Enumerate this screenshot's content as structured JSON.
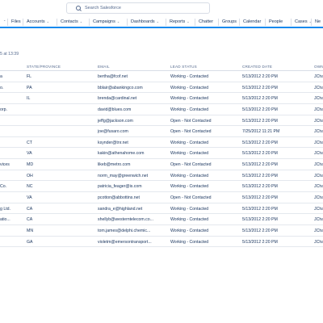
{
  "search": {
    "placeholder": "Search Salesforce"
  },
  "nav": {
    "items": [
      {
        "label": "Files",
        "dropdown": false
      },
      {
        "label": "Accounts",
        "dropdown": true
      },
      {
        "label": "Contacts",
        "dropdown": true
      },
      {
        "label": "Campaigns",
        "dropdown": true
      },
      {
        "label": "Dashboards",
        "dropdown": true
      },
      {
        "label": "Reports",
        "dropdown": true
      },
      {
        "label": "Chatter",
        "dropdown": false
      },
      {
        "label": "Groups",
        "dropdown": false
      },
      {
        "label": "Calendar",
        "dropdown": false
      },
      {
        "label": "People",
        "dropdown": false
      },
      {
        "label": "Cases",
        "dropdown": true
      },
      {
        "label": "Ne",
        "dropdown": false
      }
    ]
  },
  "subtitle": "5 at 13:39",
  "table": {
    "columns": [
      "",
      "STATE/PROVINCE",
      "EMAIL",
      "LEAD STATUS",
      "CREATED DATE",
      "OWN"
    ],
    "rows": [
      [
        "a",
        "FL",
        "bertha@fcof.net",
        "Working - Contacted",
        "5/13/2012 2:20 PM",
        "JCha"
      ],
      [
        "o.",
        "PA",
        "bblair@abankingco.com",
        "Working - Contacted",
        "5/13/2012 2:20 PM",
        "JCha"
      ],
      [
        "",
        "IL",
        "brenda@cardinal.net",
        "Working - Contacted",
        "5/13/2012 2:20 PM",
        "JCha"
      ],
      [
        "orp.",
        "",
        "david@blues.com",
        "Working - Contacted",
        "5/13/2012 2:20 PM",
        "JCha"
      ],
      [
        "",
        "",
        "jeffg@jackson.com",
        "Open - Not Contacted",
        "5/13/2012 2:20 PM",
        "JCha"
      ],
      [
        "",
        "",
        "joe@fusaro.com",
        "Open - Not Contacted",
        "7/25/2012 11:21 PM",
        "JCha"
      ],
      [
        "",
        "CT",
        "ksynder@tnr.net",
        "Working - Contacted",
        "5/13/2012 2:20 PM",
        "JCha"
      ],
      [
        "",
        "VA",
        "kakin@athenahome.com",
        "Working - Contacted",
        "5/13/2012 2:20 PM",
        "JCha"
      ],
      [
        "vices",
        "MD",
        "likeb@metro.com",
        "Open - Not Contacted",
        "5/13/2012 2:20 PM",
        "JCha"
      ],
      [
        "",
        "OH",
        "norm_may@greenwich.net",
        "Working - Contacted",
        "5/13/2012 2:20 PM",
        "JCha"
      ],
      [
        "Co.",
        "NC",
        "patricia_feager@is.com",
        "Working - Contacted",
        "5/13/2012 2:20 PM",
        "JCha"
      ],
      [
        "",
        "VA",
        "pcotton@abbottins.net",
        "Open - Not Contacted",
        "5/13/2012 2:20 PM",
        "JCha"
      ],
      [
        "g Ltd.",
        "CA",
        "sandra_e@highland.net",
        "Working - Contacted",
        "5/13/2012 2:20 PM",
        "JCha"
      ],
      [
        "atio...",
        "CA",
        "shellyb@westerntelecom.co...",
        "Working - Contacted",
        "5/13/2012 2:20 PM",
        "JCha"
      ],
      [
        "",
        "MN",
        "tom.james@delphi.chemic...",
        "Working - Contacted",
        "5/13/2012 2:20 PM",
        "JCha"
      ],
      [
        "",
        "GA",
        "violetm@emersontransport...",
        "Working - Contacted",
        "5/13/2012 2:20 PM",
        "JCha"
      ]
    ]
  }
}
